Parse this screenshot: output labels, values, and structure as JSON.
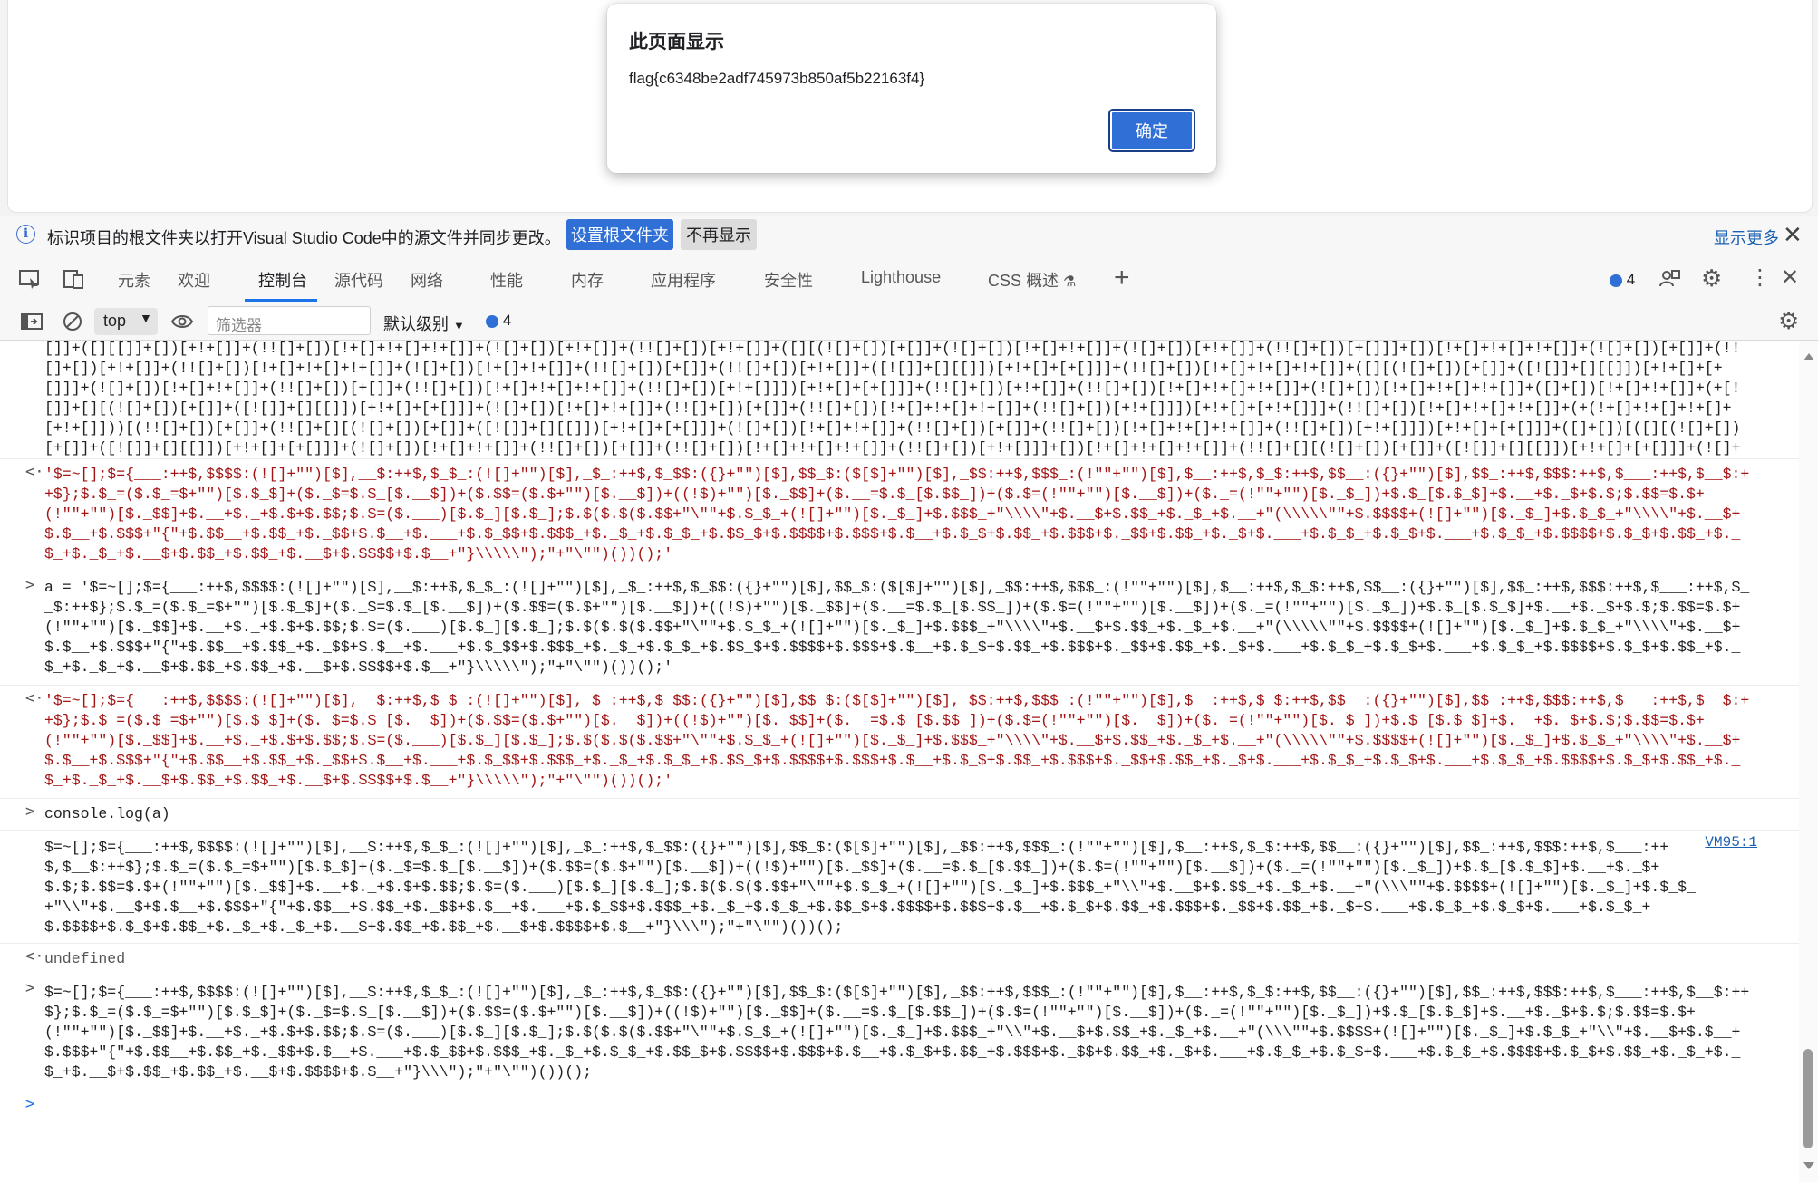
{
  "alert": {
    "title": "此页面显示",
    "message": "flag{c6348be2adf745973b850af5b22163f4}",
    "ok_label": "确定"
  },
  "infobar": {
    "text": "标识项目的根文件夹以打开Visual Studio Code中的源文件并同步更改。",
    "set_root_label": "设置根文件夹",
    "dont_show_label": "不再显示",
    "show_more_label": "显示更多"
  },
  "devtools": {
    "tabs": [
      {
        "label": "元素"
      },
      {
        "label": "欢迎"
      },
      {
        "label": "控制台"
      },
      {
        "label": "源代码"
      },
      {
        "label": "网络"
      },
      {
        "label": "性能"
      },
      {
        "label": "内存"
      },
      {
        "label": "应用程序"
      },
      {
        "label": "安全性"
      },
      {
        "label": "Lighthouse"
      },
      {
        "label": "CSS 概述"
      }
    ],
    "active_tab": "控制台",
    "issues_count": "4"
  },
  "console_toolbar": {
    "context": "top",
    "filter_placeholder": "筛选器",
    "levels_label": "默认级别",
    "issues_count": "4"
  },
  "console": {
    "entries": [
      {
        "type": "output",
        "marker": "",
        "text": "[]]+([][[]]+[])[+!+[]]+(!![]+[])[!+[]+!+[]+!+[]]+(![]+[])[+!+[]]+(!![]+[])[+!+[]]+([][(![]+[])[+[]]+(![]+[])[!+[]+!+[]]+(![]+[])[+!+[]]+(!![]+[])[+[]]]+[])[!+[]+!+[]+!+[]]+(![]+[])[+[]]+(!![]+[])[+!+[]]+(!![]+[])[!+[]+!+[]+!+[]]+(![]+[])[!+[]+!+[]]+(!![]+[])[+[]]+(!![]+[])[+!+[]]+([![]]+[][[]])[+!+[]+[+[]]]+(!![]+[])[!+[]+!+[]+!+[]]+([][(![]+[])[+[]]+([![]]+[][[]])[+!+[]+[+[]]]+(![]+[])[!+[]+!+[]]+(!![]+[])[+[]]+(!![]+[])[!+[]+!+[]+!+[]]+(!![]+[])[+!+[]]])[+!+[]+[+[]]]+(!![]+[])[+!+[]]+(!![]+[])[!+[]+!+[]+!+[]]+(![]+[])[!+[]+!+[]+!+[]]+([]+[])[!+[]+!+[]]+(+[![]]+[][(![]+[])[+[]]+([![]]+[][[]])[+!+[]+[+[]]]+(![]+[])[!+[]+!+[]]+(!![]+[])[+[]]+(!![]+[])[!+[]+!+[]+!+[]]+(!![]+[])[+!+[]]])[+!+[]+[+!+[]]]+(!![]+[])[!+[]+!+[]+!+[]]+(+(!+[]+!+[]+!+[]+[+!+[]]))[(!![]+[])[+[]]+(!![]+[][(![]+[])[+[]]+([![]]+[][[]])[+!+[]+[+[]]]+(![]+[])[!+[]+!+[]]+(!![]+[])[+[]]+(!![]+[])[!+[]+!+[]+!+[]]+(!![]+[])[+!+[]]])[+!+[]+[+[]]]+([]+[])[([][(![]+[])[+[]]+([![]]+[][[]])[+!+[]+[+[]]]+(![]+[])[!+[]+!+[]]+(!![]+[])[+[]]+(!![]+[])[!+[]+!+[]+!+[]]+(!![]+[])[+!+[]]]+[])[!+[]+!+[]+!+[]]+(!![]+[][(![]+[])[+[]]+([![]]+[][[]])[+!+[]+[+[]]]+(![]+[])[!+[]+!+[]]+(!![]+[])[+[]]+(!![]+[])[!+[]+!+[]+!+[]]+(!![]+[])[+!+[]]])[+!+[]+[+[]]]+([][[]]+[])[+!+[]]+(![]+[])[!+[]+!+[]+!+[]]+(!![]+[])[+[]]+(!![]+[])[+!+[]]+([][[]]+[])[+[]]+([][(![]+[])[+[]]+([![]]+[][[]])[+!+[]+[+[]]]+(![]+[])[!+[]+!+[]]+(!![]+[])[+[]]+(!![]+[])[!+[]+!+[]+!+[]]+(!![]+[])[+!+[]]]+[])[!+[]+!+[]+!+[]]+(!![]+[])[+[]]+(!![]+[][(![]+[])[+[]]+([![]]+[][[]])[+!+[]+[+[]]]+(![]+[])[!+[]+!+[]]+(!![]+[])[+[]]+(!![]+[])[!+[]+!+[]+!+[]]+(!![]+[])[+!+[]]])[+!+[]+[+[]]]+(!![]+[])[+!+[]]]((!![]+[])[+!+[]]+(!![]+[])[!+[]+!+[]+!+[]]+(!![]+[])[+[]]+([][[]]+[])[+[]]+(!![]+[])[+!+[]]+([][[]]+[])[+!+[]]+(+[![]]+[][(![]+[])[+[]]+([![]]+[][[]])[+!+[]+[+[]]]+(![]+[])[!+[]+!+[]]+(!![]+[])[+[]]+(!![]+[])[!+[]+!+[]+!+[]]+(!![]+[])[+!+[]]])[+!+[]+[+!+[]]]+(![]+[])[+!+[]]+(!![]+[])[+[]])())"
      },
      {
        "type": "result",
        "marker": "<·",
        "string": true,
        "text": "'$=~[];$={___:++$,$$$$:(![]+\"\")[$],__$:++$,$_$_:(![]+\"\")[$],_$_:++$,$_$$:({}+\"\")[$],$$_$:($[$]+\"\")[$],_$$:++$,$$$_:(!\"\"+\"\")[$],$__:++$,$_$:++$,$$__:({}+\"\")[$],$$_:++$,$$$:++$,$___:++$,$__$:++$};$.$_=($.$_=$+\"\")[$.$_$]+($._$=$.$_[$.__$])+($.$$=($.$+\"\")[$.__$])+((!$)+\"\")[$._$$]+($.__=$.$_[$.$$_])+($.$=(!\"\"+\"\")[$.__$])+($._=(!\"\"+\"\")[$._$_])+$.$_[$.$_$]+$.__+$._$+$.$;$.$$=$.$+(!\"\"+\"\")[$._$$]+$.__+$._+$.$+$.$$;$.$=($.___)[$.$_][$.$_];$.$($.$($.$$+\"\\\"\"+$.$_$_+(![]+\"\")[$._$_]+$.$$$_+\"\\\\\\\\\"+$.__$+$.$$_+$._$_+$.__+\"(\\\\\\\\\\\"\"+$.$$$$+(![]+\"\")[$._$_]+$.$_$_+\"\\\\\\\\\"+$.__$+$.$__+$.$$$+\"{\"+$.$$__+$.$$_+$._$$+$.$__+$.___+$.$_$$+$.$$$_+$._$_+$.$_$_+$.$$_$+$.$$$$+$.$$$+$.$__+$.$_$+$.$$_+$.$$$+$._$$+$.$$_+$._$+$.___+$.$_$_+$.$_$+$.___+$.$_$_+$.$$$$+$.$_$+$.$$_+$._$_+$._$_+$.__$+$.$$_+$.$$_+$.__$+$.$$$$+$.$__+\"}\\\\\\\\\\\");\"+\"\\\"\")())();'"
      },
      {
        "type": "input",
        "marker": ">",
        "text": "a = '$=~[];$={___:++$,$$$$:(![]+\"\")[$],__$:++$,$_$_:(![]+\"\")[$],_$_:++$,$_$$:({}+\"\")[$],$$_$:($[$]+\"\")[$],_$$:++$,$$$_:(!\"\"+\"\")[$],$__:++$,$_$:++$,$$__:({}+\"\")[$],$$_:++$,$$$:++$,$___:++$,$__$:++$};$.$_=($.$_=$+\"\")[$.$_$]+($._$=$.$_[$.__$])+($.$$=($.$+\"\")[$.__$])+((!$)+\"\")[$._$$]+($.__=$.$_[$.$$_])+($.$=(!\"\"+\"\")[$.__$])+($._=(!\"\"+\"\")[$._$_])+$.$_[$.$_$]+$.__+$._$+$.$;$.$$=$.$+(!\"\"+\"\")[$._$$]+$.__+$._+$.$+$.$$;$.$=($.___)[$.$_][$.$_];$.$($.$($.$$+\"\\\"\"+$.$_$_+(![]+\"\")[$._$_]+$.$$$_+\"\\\\\\\\\"+$.__$+$.$$_+$._$_+$.__+\"(\\\\\\\\\\\"\"+$.$$$$+(![]+\"\")[$._$_]+$.$_$_+\"\\\\\\\\\"+$.__$+$.$__+$.$$$+\"{\"+$.$$__+$.$$_+$._$$+$.$__+$.___+$.$_$$+$.$$$_+$._$_+$.$_$_+$.$$_$+$.$$$$+$.$$$+$.$__+$.$_$+$.$$_+$.$$$+$._$$+$.$$_+$._$+$.___+$.$_$_+$.$_$+$.___+$.$_$_+$.$$$$+$.$_$+$.$$_+$._$_+$._$_+$.__$+$.$$_+$.$$_+$.__$+$.$$$$+$.$__+\"}\\\\\\\\\\\");\"+\"\\\"\")())();'"
      },
      {
        "type": "result",
        "marker": "<·",
        "string": true,
        "text": "'$=~[];$={___:++$,$$$$:(![]+\"\")[$],__$:++$,$_$_:(![]+\"\")[$],_$_:++$,$_$$:({}+\"\")[$],$$_$:($[$]+\"\")[$],_$$:++$,$$$_:(!\"\"+\"\")[$],$__:++$,$_$:++$,$$__:({}+\"\")[$],$$_:++$,$$$:++$,$___:++$,$__$:++$};$.$_=($.$_=$+\"\")[$.$_$]+($._$=$.$_[$.__$])+($.$$=($.$+\"\")[$.__$])+((!$)+\"\")[$._$$]+($.__=$.$_[$.$$_])+($.$=(!\"\"+\"\")[$.__$])+($._=(!\"\"+\"\")[$._$_])+$.$_[$.$_$]+$.__+$._$+$.$;$.$$=$.$+(!\"\"+\"\")[$._$$]+$.__+$._+$.$+$.$$;$.$=($.___)[$.$_][$.$_];$.$($.$($.$$+\"\\\"\"+$.$_$_+(![]+\"\")[$._$_]+$.$$$_+\"\\\\\\\\\"+$.__$+$.$$_+$._$_+$.__+\"(\\\\\\\\\\\"\"+$.$$$$+(![]+\"\")[$._$_]+$.$_$_+\"\\\\\\\\\"+$.__$+$.$__+$.$$$+\"{\"+$.$$__+$.$$_+$._$$+$.$__+$.___+$.$_$$+$.$$$_+$._$_+$.$_$_+$.$$_$+$.$$$$+$.$$$+$.$__+$.$_$+$.$$_+$.$$$+$._$$+$.$$_+$._$+$.___+$.$_$_+$.$_$+$.___+$.$_$_+$.$$$$+$.$_$+$.$$_+$._$_+$._$_+$.__$+$.$$_+$.$$_+$.__$+$.$$$$+$.$__+\"}\\\\\\\\\\\");\"+\"\\\"\")())();'"
      },
      {
        "type": "input",
        "marker": ">",
        "text": "console.log(a)"
      },
      {
        "type": "log",
        "marker": "",
        "link": "VM95:1",
        "text": "$=~[];$={___:++$,$$$$:(![]+\"\")[$],__$:++$,$_$_:(![]+\"\")[$],_$_:++$,$_$$:({}+\"\")[$],$$_$:($[$]+\"\")[$],_$$:++$,$$$_:(!\"\"+\"\")[$],$__:++$,$_$:++$,$$__:({}+\"\")[$],$$_:++$,$$$:++$,$___:++$,$__$:++$};$.$_=($.$_=$+\"\")[$.$_$]+($._$=$.$_[$.__$])+($.$$=($.$+\"\")[$.__$])+((!$)+\"\")[$._$$]+($.__=$.$_[$.$$_])+($.$=(!\"\"+\"\")[$.__$])+($._=(!\"\"+\"\")[$._$_])+$.$_[$.$_$]+$.__+$._$+$.$;$.$$=$.$+(!\"\"+\"\")[$._$$]+$.__+$._+$.$+$.$$;$.$=($.___)[$.$_][$.$_];$.$($.$($.$$+\"\\\"\"+$.$_$_+(![]+\"\")[$._$_]+$.$$$_+\"\\\\\"+$.__$+$.$$_+$._$_+$.__+\"(\\\\\\\"\"+$.$$$$+(![]+\"\")[$._$_]+$.$_$_+\"\\\\\"+$.__$+$.$__+$.$$$+\"{\"+$.$$__+$.$$_+$._$$+$.$__+$.___+$.$_$$+$.$$$_+$._$_+$.$_$_+$.$$_$+$.$$$$+$.$$$+$.$__+$.$_$+$.$$_+$.$$$+$._$$+$.$$_+$._$+$.___+$.$_$_+$.$_$+$.___+$.$_$_+$.$$$$+$.$_$+$.$$_+$._$_+$._$_+$.__$+$.$$_+$.$$_+$.__$+$.$$$$+$.$__+\"}\\\\\\\");\"+\"\\\"\")())();"
      },
      {
        "type": "result",
        "marker": "<·",
        "string": false,
        "text": "undefined"
      },
      {
        "type": "input",
        "marker": ">",
        "text": "$=~[];$={___:++$,$$$$:(![]+\"\")[$],__$:++$,$_$_:(![]+\"\")[$],_$_:++$,$_$$:({}+\"\")[$],$$_$:($[$]+\"\")[$],_$$:++$,$$$_:(!\"\"+\"\")[$],$__:++$,$_$:++$,$$__:({}+\"\")[$],$$_:++$,$$$:++$,$___:++$,$__$:++$};$.$_=($.$_=$+\"\")[$.$_$]+($._$=$.$_[$.__$])+($.$$=($.$+\"\")[$.__$])+((!$)+\"\")[$._$$]+($.__=$.$_[$.$$_])+($.$=(!\"\"+\"\")[$.__$])+($._=(!\"\"+\"\")[$._$_])+$.$_[$.$_$]+$.__+$._$+$.$;$.$$=$.$+(!\"\"+\"\")[$._$$]+$.__+$._+$.$+$.$$;$.$=($.___)[$.$_][$.$_];$.$($.$($.$$+\"\\\"\"+$.$_$_+(![]+\"\")[$._$_]+$.$$$_+\"\\\\\"+$.__$+$.$$_+$._$_+$.__+\"(\\\\\\\"\"+$.$$$$+(![]+\"\")[$._$_]+$.$_$_+\"\\\\\"+$.__$+$.$__+$.$$$+\"{\"+$.$$__+$.$$_+$._$$+$.$__+$.___+$.$_$$+$.$$$_+$._$_+$.$_$_+$.$$_$+$.$$$$+$.$$$+$.$__+$.$_$+$.$$_+$.$$$+$._$$+$.$$_+$._$+$.___+$.$_$_+$.$_$+$.___+$.$_$_+$.$$$$+$.$_$+$.$$_+$._$_+$._$_+$.__$+$.$$_+$.$$_+$.__$+$.$$$$+$.$__+\"}\\\\\\\");\"+\"\\\"\")())();"
      }
    ],
    "prompt_marker": ">"
  }
}
